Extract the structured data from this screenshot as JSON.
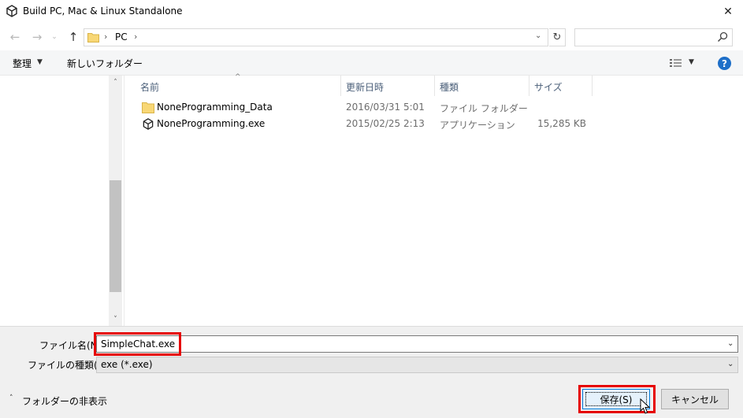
{
  "window": {
    "title": "Build PC, Mac & Linux Standalone",
    "close_glyph": "✕"
  },
  "nav": {
    "back_glyph": "←",
    "forward_glyph": "→",
    "recent_glyph": "⌄",
    "up_glyph": "↑",
    "separator": "›",
    "location": "PC",
    "dropdown_glyph": "⌄",
    "refresh_glyph": "↻",
    "search_placeholder": ""
  },
  "toolbar": {
    "organize_label": "整理",
    "caret": "▼",
    "new_folder_label": "新しいフォルダー",
    "help_label": "?"
  },
  "file_list": {
    "columns": [
      "名前",
      "更新日時",
      "種類",
      "サイズ"
    ],
    "sort_glyph": "^",
    "rows": [
      {
        "name": "NoneProgramming_Data",
        "date": "2016/03/31 5:01",
        "type": "ファイル フォルダー",
        "size": "",
        "icon": "folder-icon"
      },
      {
        "name": "NoneProgramming.exe",
        "date": "2015/02/25 2:13",
        "type": "アプリケーション",
        "size": "15,285 KB",
        "icon": "unity-icon"
      }
    ]
  },
  "scrollbar": {
    "up_glyph": "˄",
    "down_glyph": "˅"
  },
  "form": {
    "filename_label": "ファイル名(N):",
    "filename_value": "SimpleChat.exe",
    "filetype_label": "ファイルの種類(T):",
    "filetype_value": "exe (*.exe)",
    "dropdown_glyph": "⌄"
  },
  "footer": {
    "hide_caret": "˄",
    "hide_folders_label": "フォルダーの非表示",
    "save_label": "保存(S)",
    "cancel_label": "キャンセル"
  },
  "colors": {
    "accent": "#0078d7",
    "highlight": "#e60000",
    "help": "#1e6fc8",
    "folder": "#f8d775"
  }
}
